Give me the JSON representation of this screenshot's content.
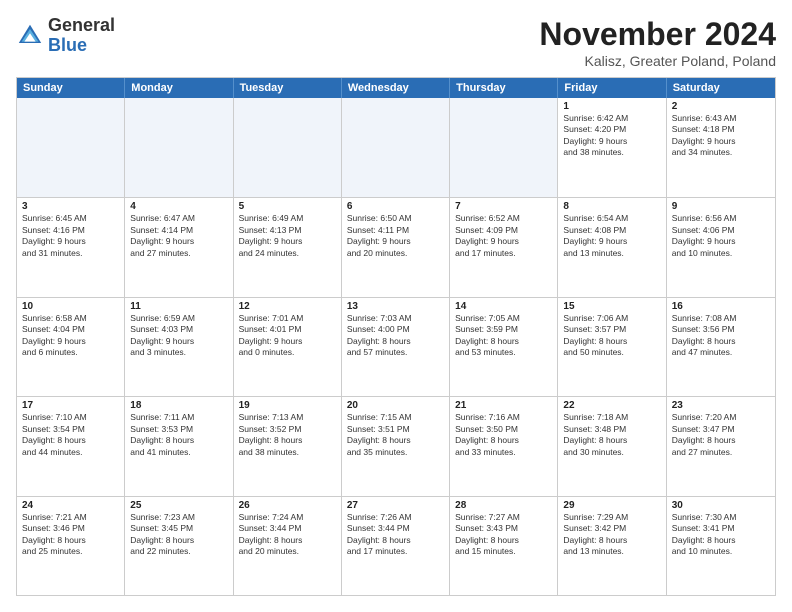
{
  "logo": {
    "general": "General",
    "blue": "Blue"
  },
  "title": "November 2024",
  "location": "Kalisz, Greater Poland, Poland",
  "headers": [
    "Sunday",
    "Monday",
    "Tuesday",
    "Wednesday",
    "Thursday",
    "Friday",
    "Saturday"
  ],
  "weeks": [
    [
      {
        "day": "",
        "info": ""
      },
      {
        "day": "",
        "info": ""
      },
      {
        "day": "",
        "info": ""
      },
      {
        "day": "",
        "info": ""
      },
      {
        "day": "",
        "info": ""
      },
      {
        "day": "1",
        "info": "Sunrise: 6:42 AM\nSunset: 4:20 PM\nDaylight: 9 hours\nand 38 minutes."
      },
      {
        "day": "2",
        "info": "Sunrise: 6:43 AM\nSunset: 4:18 PM\nDaylight: 9 hours\nand 34 minutes."
      }
    ],
    [
      {
        "day": "3",
        "info": "Sunrise: 6:45 AM\nSunset: 4:16 PM\nDaylight: 9 hours\nand 31 minutes."
      },
      {
        "day": "4",
        "info": "Sunrise: 6:47 AM\nSunset: 4:14 PM\nDaylight: 9 hours\nand 27 minutes."
      },
      {
        "day": "5",
        "info": "Sunrise: 6:49 AM\nSunset: 4:13 PM\nDaylight: 9 hours\nand 24 minutes."
      },
      {
        "day": "6",
        "info": "Sunrise: 6:50 AM\nSunset: 4:11 PM\nDaylight: 9 hours\nand 20 minutes."
      },
      {
        "day": "7",
        "info": "Sunrise: 6:52 AM\nSunset: 4:09 PM\nDaylight: 9 hours\nand 17 minutes."
      },
      {
        "day": "8",
        "info": "Sunrise: 6:54 AM\nSunset: 4:08 PM\nDaylight: 9 hours\nand 13 minutes."
      },
      {
        "day": "9",
        "info": "Sunrise: 6:56 AM\nSunset: 4:06 PM\nDaylight: 9 hours\nand 10 minutes."
      }
    ],
    [
      {
        "day": "10",
        "info": "Sunrise: 6:58 AM\nSunset: 4:04 PM\nDaylight: 9 hours\nand 6 minutes."
      },
      {
        "day": "11",
        "info": "Sunrise: 6:59 AM\nSunset: 4:03 PM\nDaylight: 9 hours\nand 3 minutes."
      },
      {
        "day": "12",
        "info": "Sunrise: 7:01 AM\nSunset: 4:01 PM\nDaylight: 9 hours\nand 0 minutes."
      },
      {
        "day": "13",
        "info": "Sunrise: 7:03 AM\nSunset: 4:00 PM\nDaylight: 8 hours\nand 57 minutes."
      },
      {
        "day": "14",
        "info": "Sunrise: 7:05 AM\nSunset: 3:59 PM\nDaylight: 8 hours\nand 53 minutes."
      },
      {
        "day": "15",
        "info": "Sunrise: 7:06 AM\nSunset: 3:57 PM\nDaylight: 8 hours\nand 50 minutes."
      },
      {
        "day": "16",
        "info": "Sunrise: 7:08 AM\nSunset: 3:56 PM\nDaylight: 8 hours\nand 47 minutes."
      }
    ],
    [
      {
        "day": "17",
        "info": "Sunrise: 7:10 AM\nSunset: 3:54 PM\nDaylight: 8 hours\nand 44 minutes."
      },
      {
        "day": "18",
        "info": "Sunrise: 7:11 AM\nSunset: 3:53 PM\nDaylight: 8 hours\nand 41 minutes."
      },
      {
        "day": "19",
        "info": "Sunrise: 7:13 AM\nSunset: 3:52 PM\nDaylight: 8 hours\nand 38 minutes."
      },
      {
        "day": "20",
        "info": "Sunrise: 7:15 AM\nSunset: 3:51 PM\nDaylight: 8 hours\nand 35 minutes."
      },
      {
        "day": "21",
        "info": "Sunrise: 7:16 AM\nSunset: 3:50 PM\nDaylight: 8 hours\nand 33 minutes."
      },
      {
        "day": "22",
        "info": "Sunrise: 7:18 AM\nSunset: 3:48 PM\nDaylight: 8 hours\nand 30 minutes."
      },
      {
        "day": "23",
        "info": "Sunrise: 7:20 AM\nSunset: 3:47 PM\nDaylight: 8 hours\nand 27 minutes."
      }
    ],
    [
      {
        "day": "24",
        "info": "Sunrise: 7:21 AM\nSunset: 3:46 PM\nDaylight: 8 hours\nand 25 minutes."
      },
      {
        "day": "25",
        "info": "Sunrise: 7:23 AM\nSunset: 3:45 PM\nDaylight: 8 hours\nand 22 minutes."
      },
      {
        "day": "26",
        "info": "Sunrise: 7:24 AM\nSunset: 3:44 PM\nDaylight: 8 hours\nand 20 minutes."
      },
      {
        "day": "27",
        "info": "Sunrise: 7:26 AM\nSunset: 3:44 PM\nDaylight: 8 hours\nand 17 minutes."
      },
      {
        "day": "28",
        "info": "Sunrise: 7:27 AM\nSunset: 3:43 PM\nDaylight: 8 hours\nand 15 minutes."
      },
      {
        "day": "29",
        "info": "Sunrise: 7:29 AM\nSunset: 3:42 PM\nDaylight: 8 hours\nand 13 minutes."
      },
      {
        "day": "30",
        "info": "Sunrise: 7:30 AM\nSunset: 3:41 PM\nDaylight: 8 hours\nand 10 minutes."
      }
    ]
  ]
}
